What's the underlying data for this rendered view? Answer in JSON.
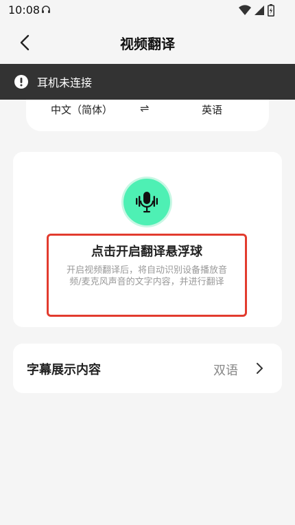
{
  "status_bar": {
    "time": "10:08",
    "icons": [
      "headset-icon",
      "wifi-icon",
      "signal-icon",
      "battery-icon"
    ]
  },
  "header": {
    "title": "视频翻译",
    "back_icon": "chevron-left-icon"
  },
  "banner": {
    "icon": "exclamation-icon",
    "text": "耳机未连接"
  },
  "language": {
    "source": "中文（简体）",
    "swap_symbol": "⇌",
    "target": "英语"
  },
  "main_card": {
    "mic_icon": "microphone-icon",
    "accent_color": "#4ef0b4",
    "title": "点击开启翻译悬浮球",
    "description": "开启视频翻译后，将自动识别设备播放音频/麦克风声音的文字内容，并进行翻译"
  },
  "subtitle_setting": {
    "label": "字幕展示内容",
    "value": "双语",
    "chevron_icon": "chevron-right-icon"
  }
}
